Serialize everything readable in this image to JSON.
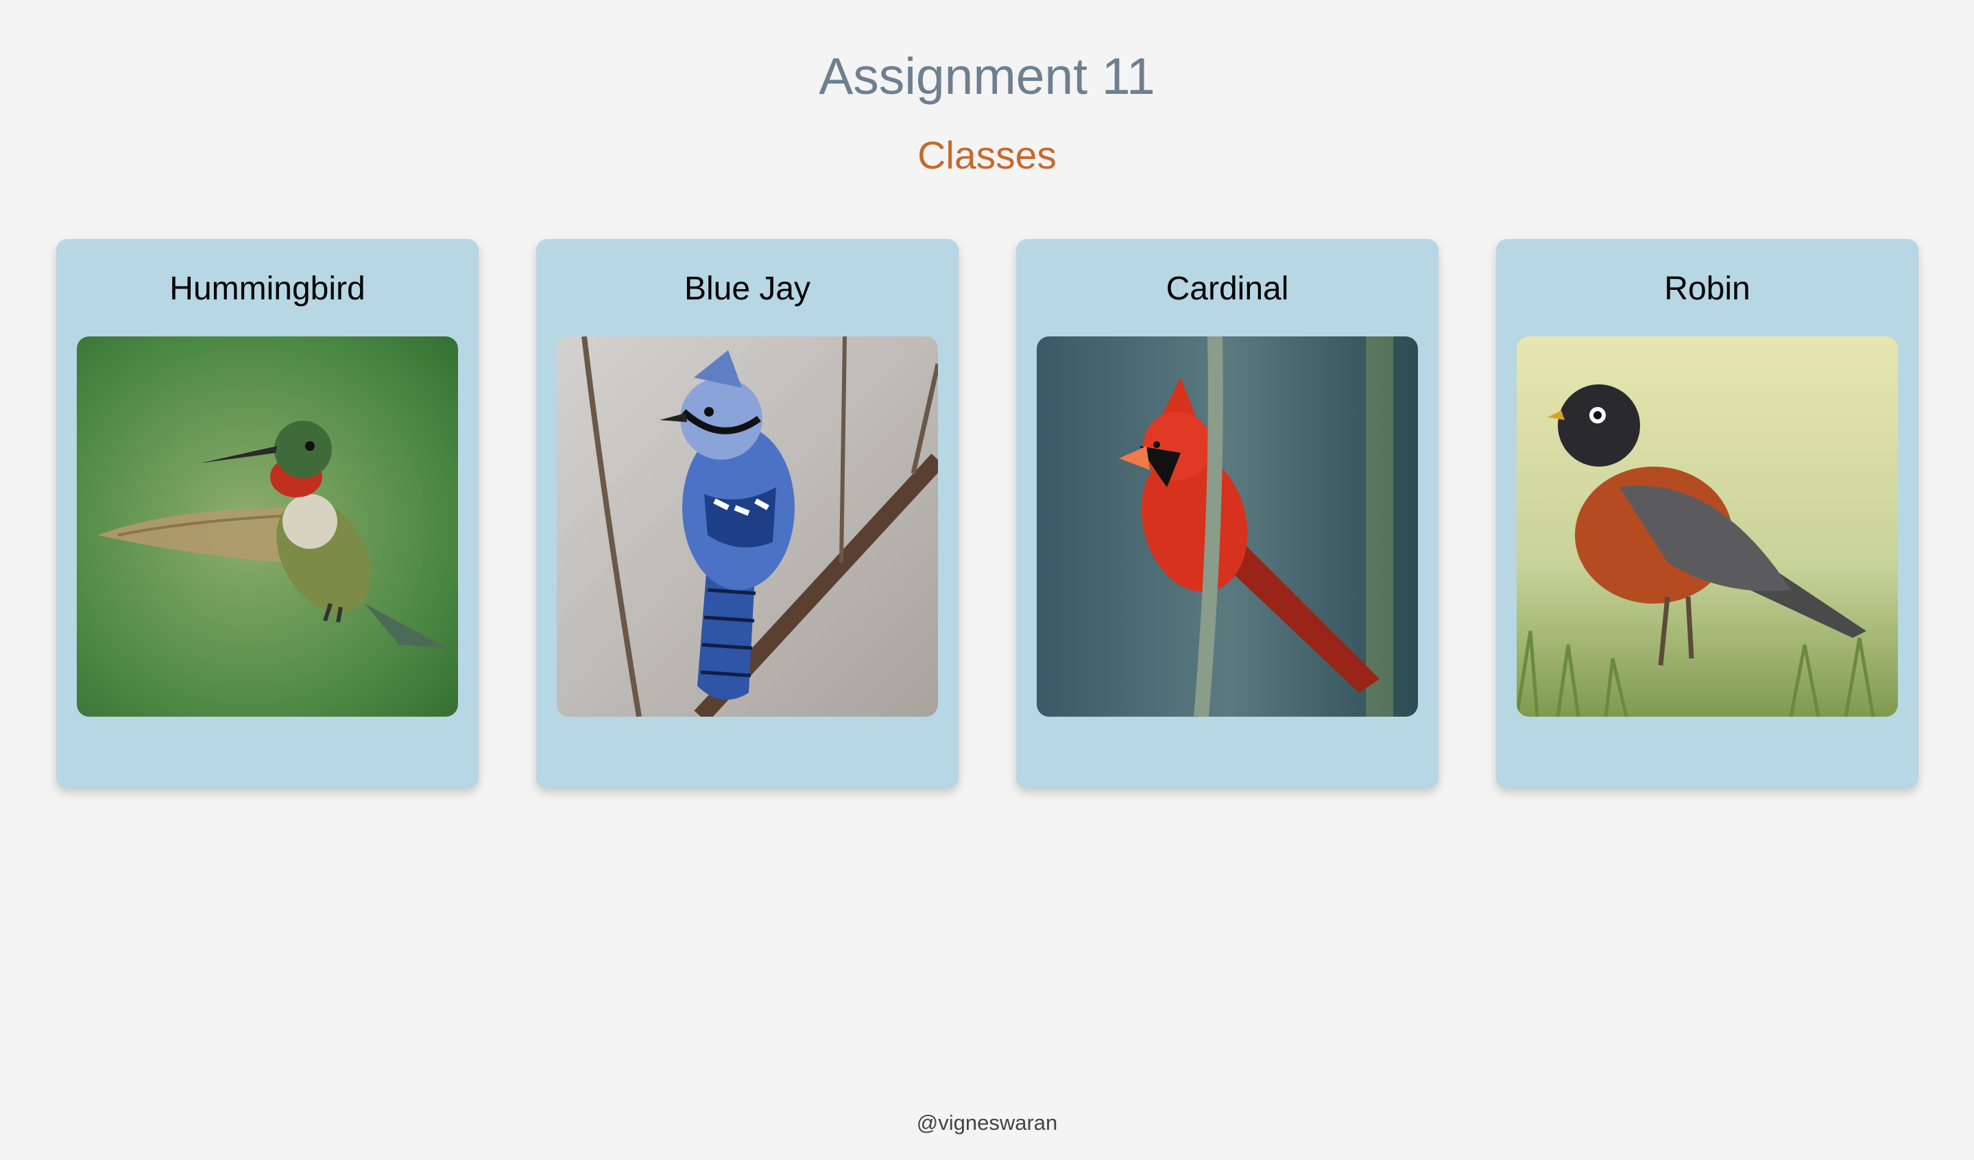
{
  "header": {
    "title": "Assignment 11",
    "subtitle": "Classes"
  },
  "cards": [
    {
      "name": "Hummingbird"
    },
    {
      "name": "Blue Jay"
    },
    {
      "name": "Cardinal"
    },
    {
      "name": "Robin"
    }
  ],
  "footer": {
    "credit": "@vigneswaran"
  },
  "colors": {
    "background": "#f4f4f4",
    "title": "#6e7f8f",
    "subtitle": "#c56a2b",
    "card": "#b6d7e3"
  }
}
